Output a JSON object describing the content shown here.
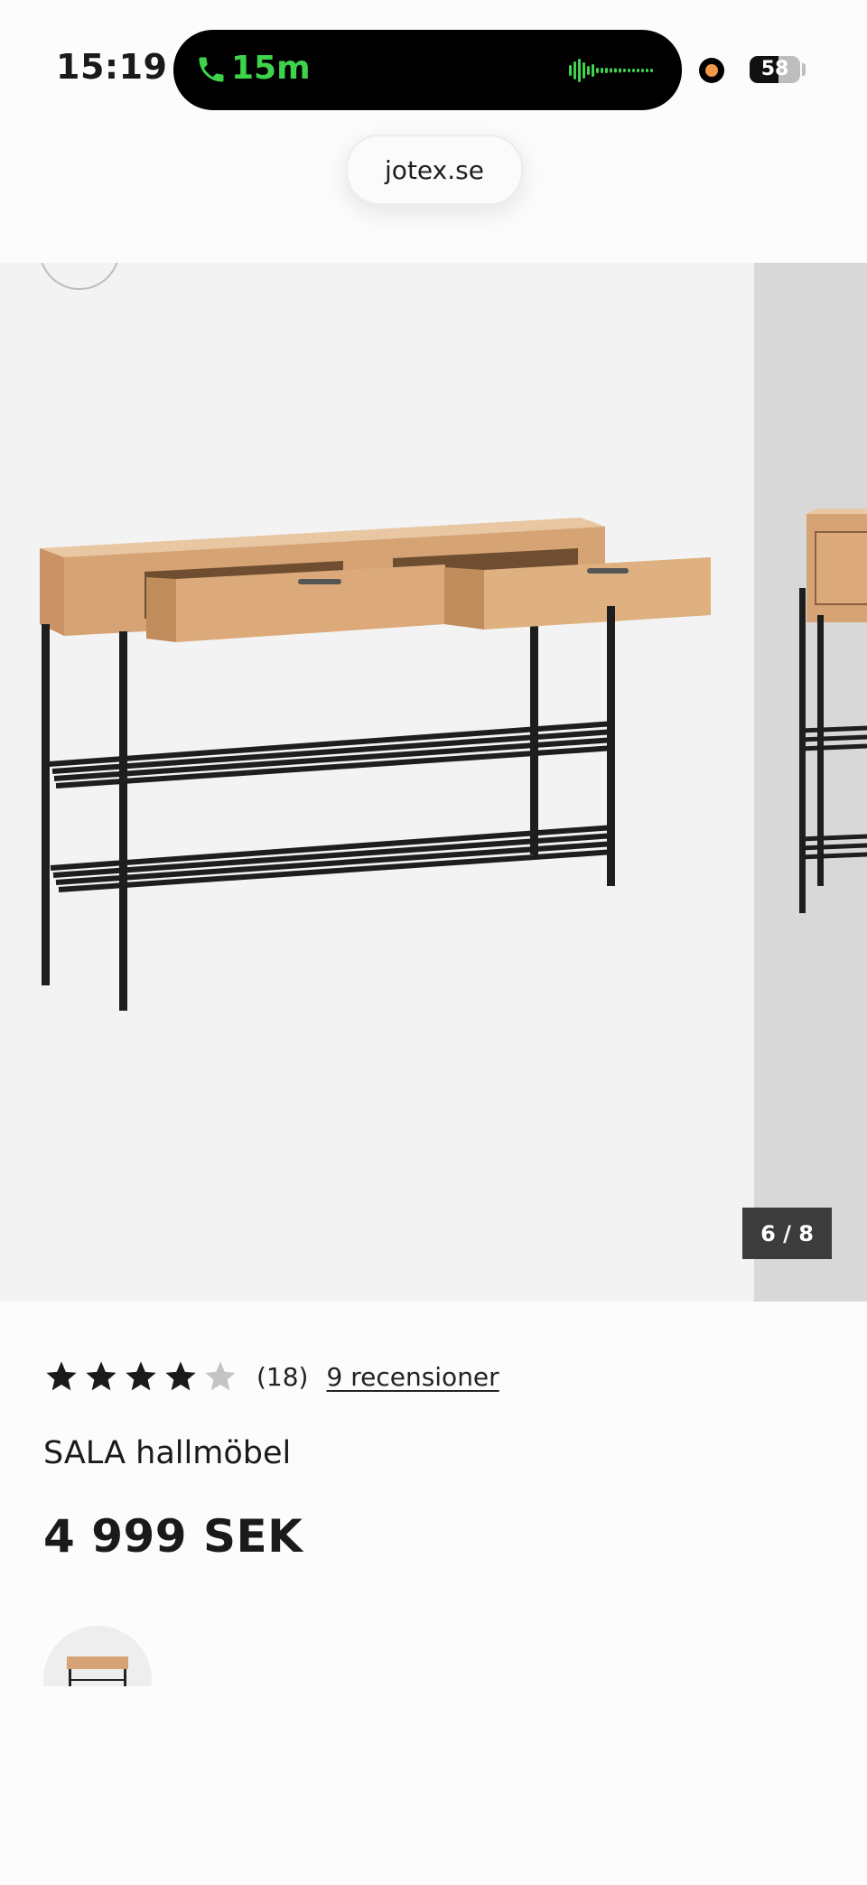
{
  "status_bar": {
    "time": "15:19",
    "call_duration": "15m",
    "battery_level": "58",
    "call_icon": "phone-icon",
    "waveform_icon": "audio-waveform-icon",
    "recording_indicator": "orange-dot-icon"
  },
  "browser": {
    "url": "jotex.se"
  },
  "gallery": {
    "counter": "6 / 8",
    "current_index": 6,
    "total": 8
  },
  "product": {
    "rating_value": 4,
    "rating_max": 5,
    "rating_count": "(18)",
    "reviews_link": "9 recensioner",
    "name": "SALA hallmöbel",
    "price": "4 999 SEK"
  },
  "colors": {
    "accent_call": "#3fd34c",
    "recording": "#f2994a",
    "text": "#1a1a1a",
    "star_filled": "#1a1a1a",
    "star_empty": "#c4c4c4",
    "counter_bg": "#3c3c3c"
  }
}
